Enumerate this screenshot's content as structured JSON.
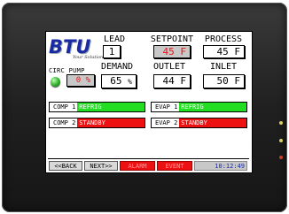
{
  "logo": {
    "text": "BTU",
    "tagline": "Your Solution"
  },
  "pump": {
    "label": "CIRC PUMP",
    "value": "0",
    "unit": "%"
  },
  "top_row": [
    {
      "label": "LEAD",
      "value": "1"
    },
    {
      "label": "SETPOINT",
      "value": "45",
      "unit": "F"
    },
    {
      "label": "PROCESS",
      "value": "45",
      "unit": "F"
    }
  ],
  "second_row": [
    {
      "label": "DEMAND",
      "value": "65",
      "unit": "%"
    },
    {
      "label": "OUTLET",
      "value": "44",
      "unit": "F"
    },
    {
      "label": "INLET",
      "value": "50",
      "unit": "F"
    }
  ],
  "status": [
    {
      "name": "COMP 1",
      "state": "REFRIG",
      "color": "#22dd22"
    },
    {
      "name": "EVAP 1",
      "state": "REFRIG",
      "color": "#22dd22"
    },
    {
      "name": "COMP 2",
      "state": "STANDBY",
      "color": "#ee1111"
    },
    {
      "name": "EVAP 2",
      "state": "STANDBY",
      "color": "#ee1111"
    }
  ],
  "nav": {
    "back": "<<BACK",
    "next": "NEXT>>",
    "alarm": "ALARM",
    "event": "EVENT",
    "time": "10:12:49"
  },
  "colors": {
    "alarm_red": "#ee1111",
    "ok_green": "#22dd22",
    "logo_blue": "#1a2aa5"
  },
  "icons": {
    "pump_indicator": "green-indicator-light"
  }
}
